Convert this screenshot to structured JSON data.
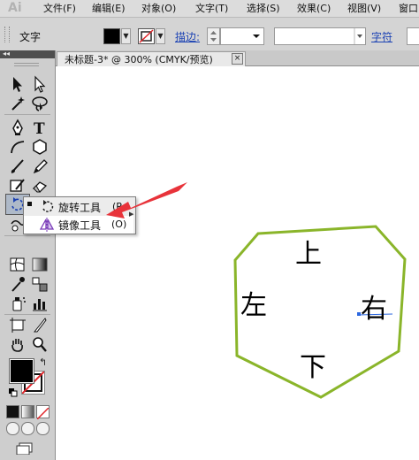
{
  "app": {
    "logo": "Ai"
  },
  "menu": {
    "items": [
      {
        "label": "文件(F)"
      },
      {
        "label": "编辑(E)"
      },
      {
        "label": "对象(O)"
      },
      {
        "label": "文字(T)"
      },
      {
        "label": "选择(S)"
      },
      {
        "label": "效果(C)"
      },
      {
        "label": "视图(V)"
      },
      {
        "label": "窗口"
      }
    ]
  },
  "control_bar": {
    "tool_name": "文字",
    "stroke_label": "描边:",
    "char_label": "字符",
    "fill_color": "#000000"
  },
  "document_tab": {
    "title": "未标题-3* @ 300% (CMYK/预览)",
    "close_glyph": "×"
  },
  "flyout": {
    "items": [
      {
        "label": "旋转工具",
        "shortcut": "(R",
        "selected": true
      },
      {
        "label": "镜像工具",
        "shortcut": "(O)",
        "selected": false
      }
    ]
  },
  "canvas": {
    "labels": {
      "top": "上",
      "left": "左",
      "right": "右",
      "bottom": "下"
    },
    "hexagon_stroke": "#8ab52a",
    "annotation_arrow_color": "#e8333a"
  }
}
